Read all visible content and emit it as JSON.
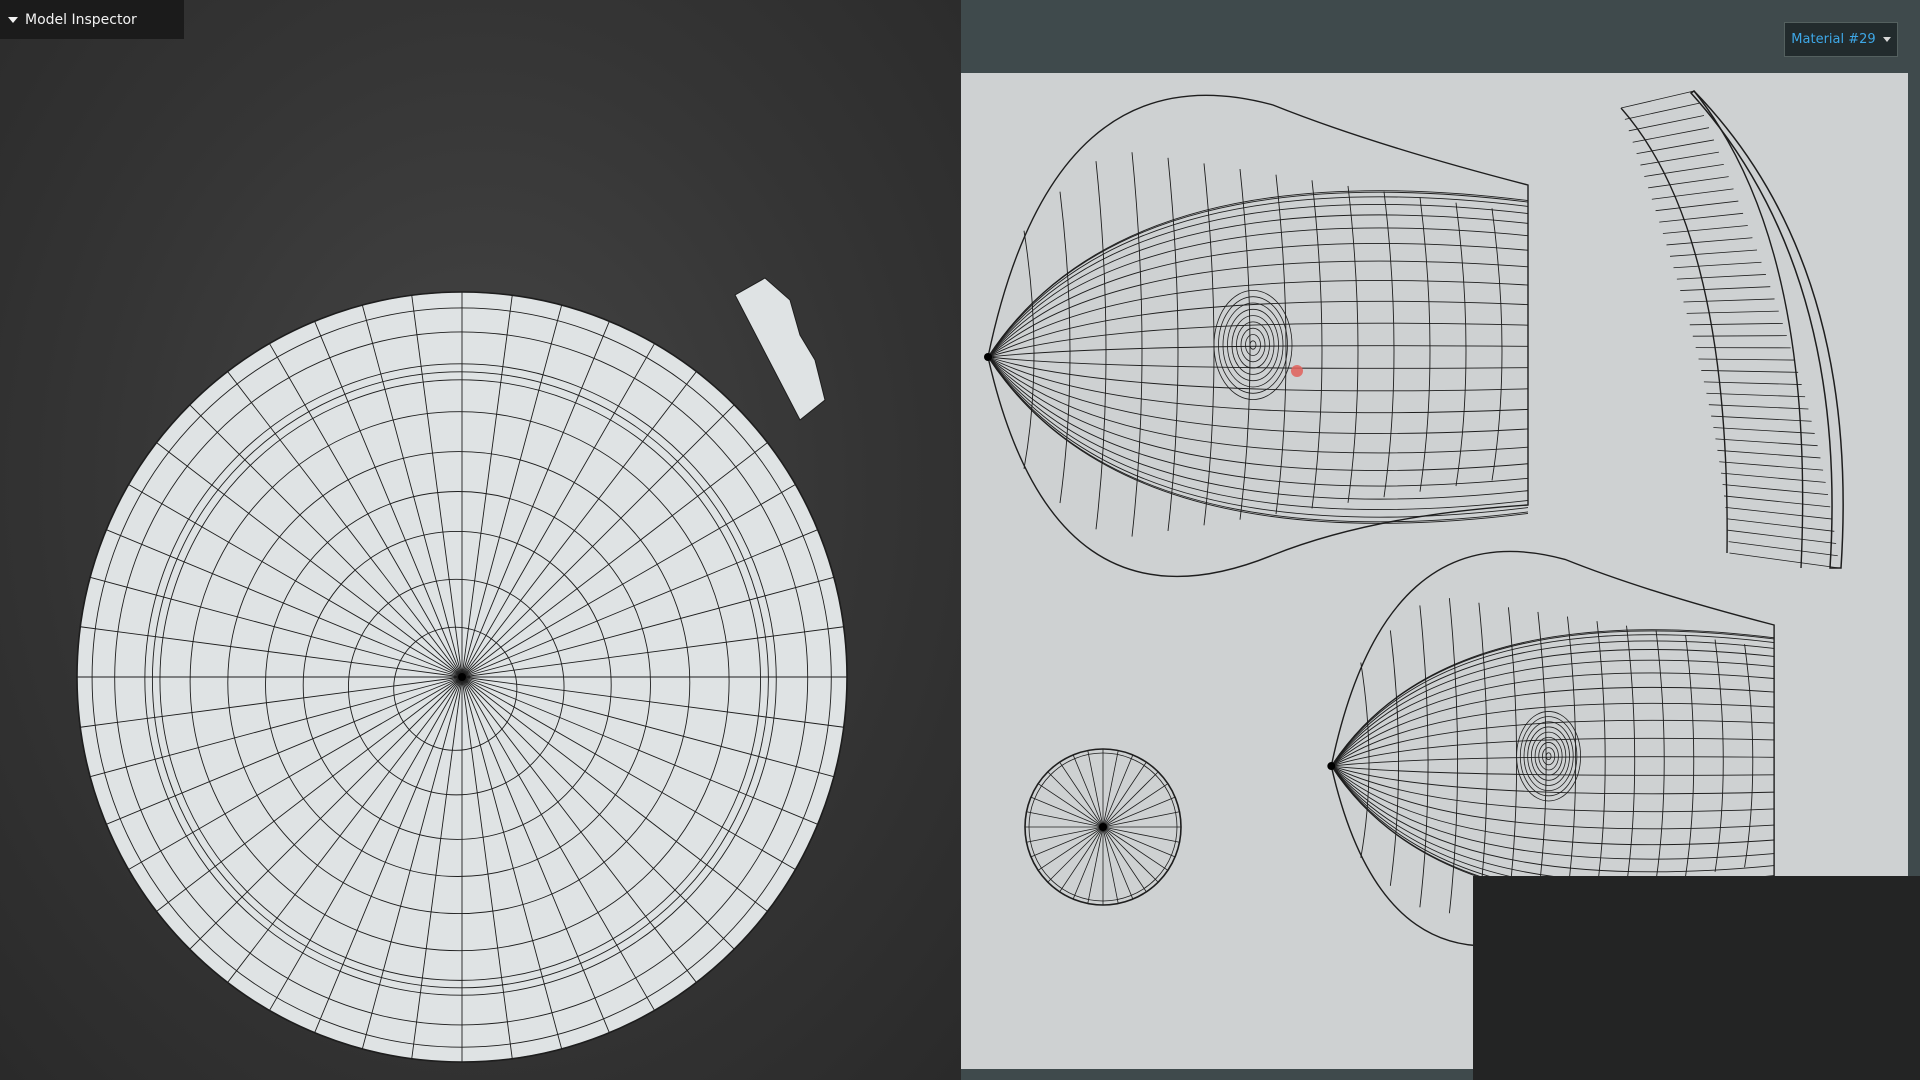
{
  "viewport3d": {
    "inspector": {
      "title": "Model Inspector",
      "expanded": true
    }
  },
  "uv_editor": {
    "material_selector": {
      "selected": "Material #29"
    },
    "marker_color": "#e0605a"
  },
  "colors": {
    "mesh_fill": "#dfe3e4",
    "wire": "#1e1e1e",
    "uv_background": "#ced1d2",
    "panel_background": "#3f4a4c",
    "accent": "#3ea7e6"
  }
}
